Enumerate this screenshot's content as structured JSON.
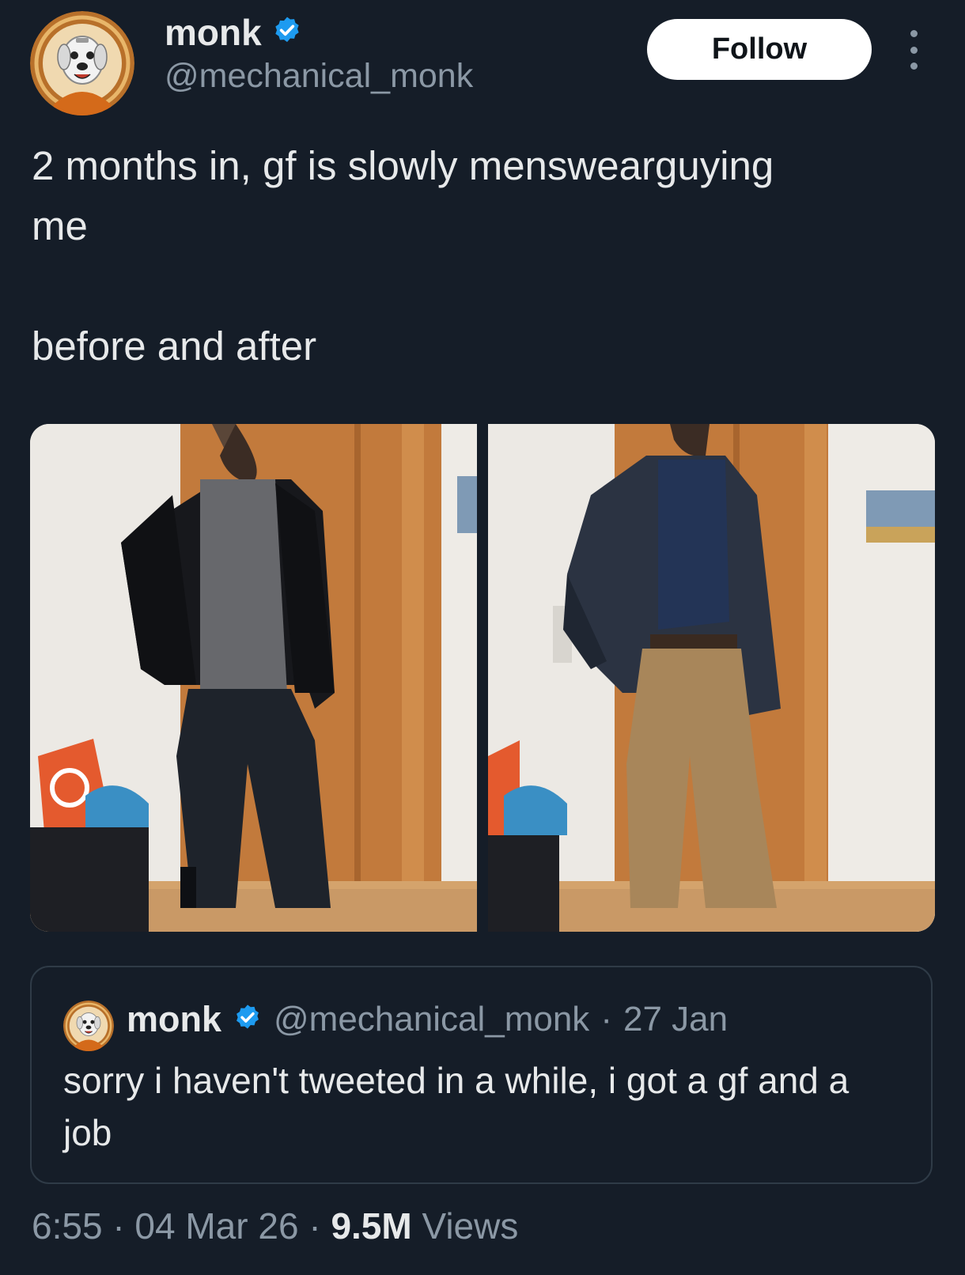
{
  "tweet": {
    "author_name": "monk",
    "author_handle": "@mechanical_monk",
    "follow_label": "Follow",
    "text": "2 months in, gf is slowly menswearguying\nme\n\nbefore and after",
    "time": "6:55",
    "date": "04 Mar 26",
    "views_count": "9.5M",
    "views_label": "Views",
    "separator": "·"
  },
  "quoted_tweet": {
    "author_name": "monk",
    "author_handle": "@mechanical_monk",
    "separator": "·",
    "date": "27 Jan",
    "text": "sorry i haven't tweeted in a while, i got a gf and a job"
  },
  "media": [
    {
      "alt": "before"
    },
    {
      "alt": "after"
    }
  ],
  "icons": {
    "verified": "verified-badge-icon",
    "more": "more-options-icon"
  },
  "colors": {
    "background": "#151d28",
    "verified_blue": "#1d9bf0",
    "muted_text": "#8b98a5"
  }
}
